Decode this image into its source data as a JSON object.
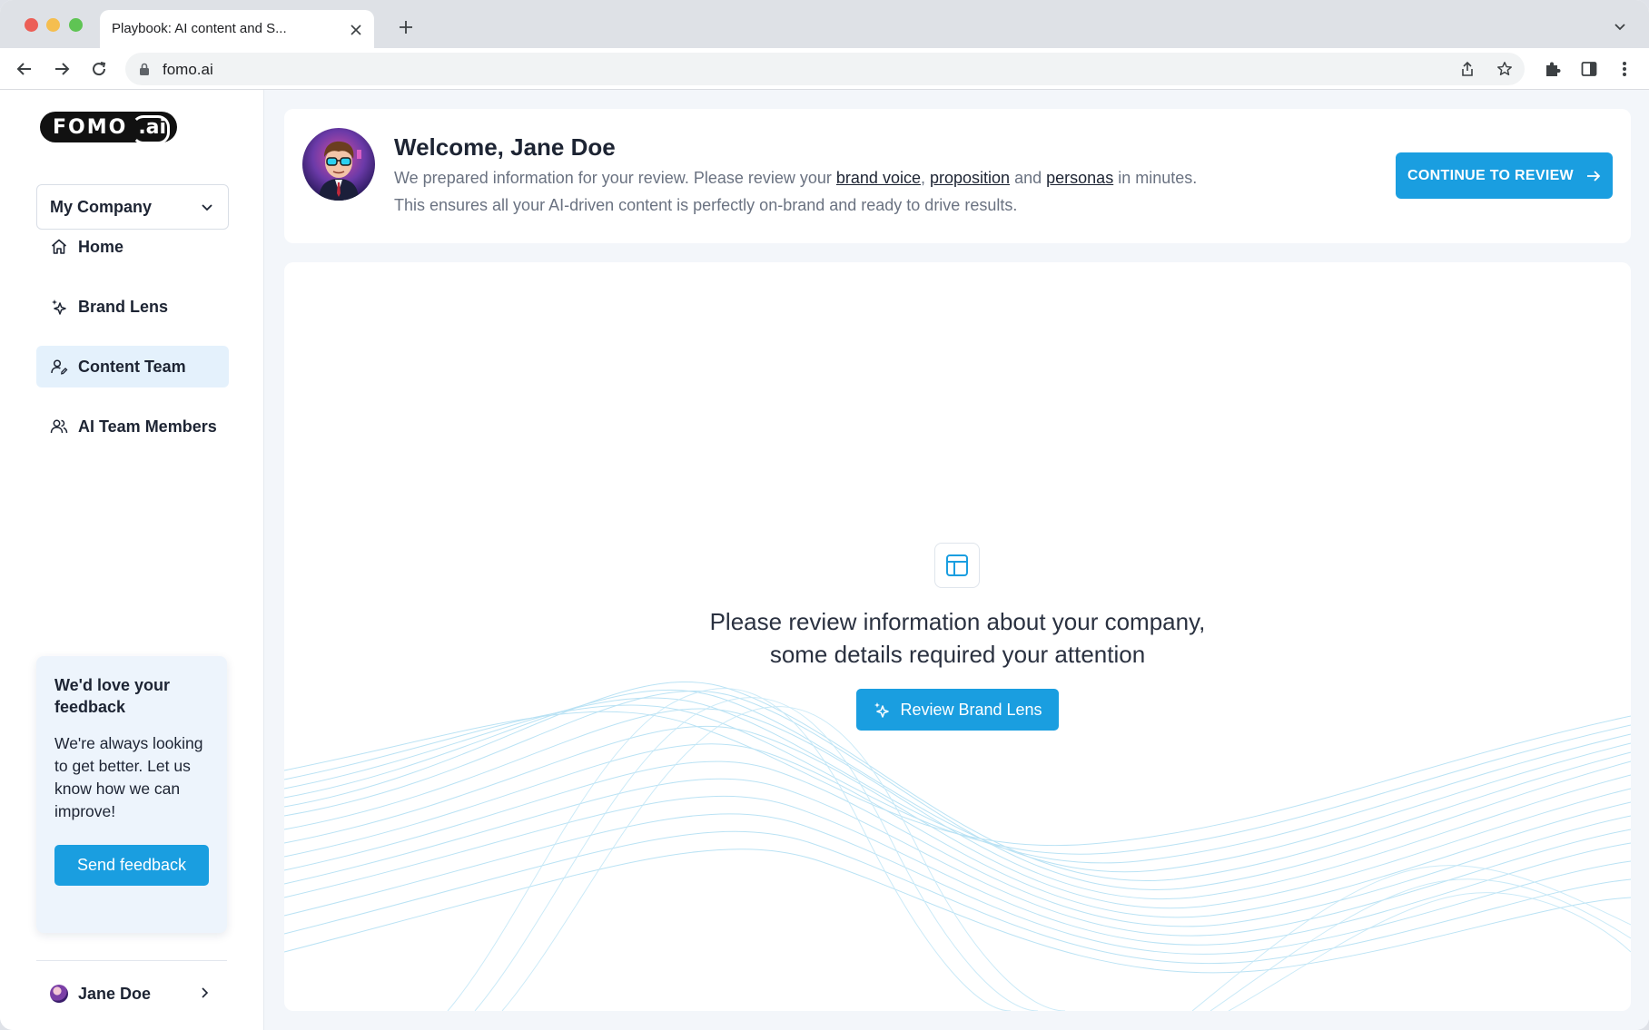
{
  "browser": {
    "tab_title": "Playbook: AI content and S...",
    "url": "fomo.ai"
  },
  "app": {
    "logo": {
      "fomo": "FOMO",
      "ai": ".ai"
    },
    "company_selector": {
      "selected": "My Company"
    },
    "nav": [
      {
        "label": "Home",
        "icon": "home-icon",
        "active": false
      },
      {
        "label": "Brand Lens",
        "icon": "sparkle-icon",
        "active": false
      },
      {
        "label": "Content Team",
        "icon": "user-edit-icon",
        "active": true
      },
      {
        "label": "AI Team Members",
        "icon": "users-icon",
        "active": false
      }
    ],
    "feedback": {
      "title": "We'd love your feedback",
      "text": "We're always looking to get better. Let us know how we can improve!",
      "button": "Send feedback"
    },
    "user": {
      "name": "Jane Doe"
    }
  },
  "welcome": {
    "title": "Welcome, Jane Doe",
    "line1_prefix": "We prepared information for your review. Please review your",
    "link_brand_voice": "brand voice",
    "comma": ",",
    "link_proposition": "proposition",
    "and": "and",
    "link_personas": "personas",
    "line1_suffix": "in minutes.",
    "line2": "This ensures all your AI-driven content is perfectly on-brand and ready to drive results.",
    "cta": "CONTINUE TO REVIEW"
  },
  "empty_state": {
    "line1": "Please review information about your company,",
    "line2": "some details required your attention",
    "button": "Review Brand Lens"
  },
  "colors": {
    "accent": "#1a9ee0",
    "active_nav_bg": "#e4f1fc",
    "feedback_bg": "#edf4fc"
  }
}
